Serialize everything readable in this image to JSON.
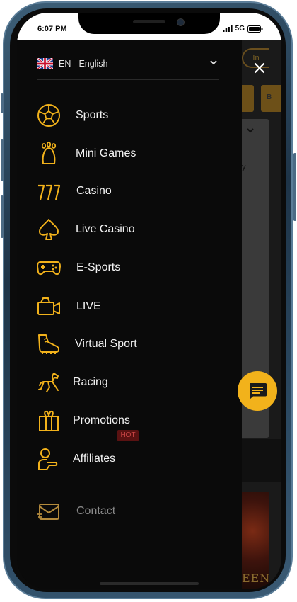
{
  "status": {
    "time": "6:07 PM",
    "network": "5G"
  },
  "language": {
    "label": "EN - English",
    "flag": "uk-flag-icon"
  },
  "menu": [
    {
      "label": "Sports",
      "icon": "soccer-ball-icon"
    },
    {
      "label": "Mini Games",
      "icon": "footprint-icon"
    },
    {
      "label": "Casino",
      "icon": "slot-777-icon"
    },
    {
      "label": "Live Casino",
      "icon": "spade-icon"
    },
    {
      "label": "E-Sports",
      "icon": "gamepad-icon"
    },
    {
      "label": "LIVE",
      "icon": "video-camera-icon"
    },
    {
      "label": "Virtual Sport",
      "icon": "football-boot-icon"
    },
    {
      "label": "Racing",
      "icon": "horse-icon"
    },
    {
      "label": "Promotions",
      "icon": "gift-icon",
      "badge": "HOT"
    },
    {
      "label": "Affiliates",
      "icon": "user-hand-icon"
    }
  ],
  "contact": {
    "label": "Contact",
    "icon": "envelope-icon"
  },
  "background": {
    "login_partial": "In",
    "tab_partial": "B",
    "card_partial": "y",
    "banner_partial": "EEN"
  },
  "colors": {
    "accent": "#f2b21b",
    "drawer_bg": "#0a0a0a",
    "hot_badge": "#5a1212"
  }
}
